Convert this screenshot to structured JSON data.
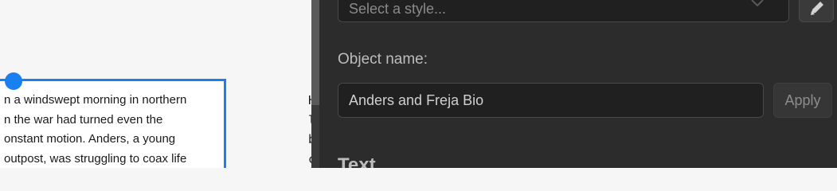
{
  "canvas": {
    "frame_lines": [
      "n a windswept morning in northern",
      "n the war had turned even the",
      "onstant motion. Anders, a young",
      "outpost, was struggling to coax life"
    ],
    "right_column_lines": [
      "H",
      "l",
      "b",
      "c"
    ]
  },
  "panel": {
    "style_select": {
      "placeholder": "Select a style..."
    },
    "object_name": {
      "label": "Object name:",
      "value": "Anders and Freja Bio"
    },
    "apply_label": "Apply",
    "section_heading": "Text"
  },
  "icons": {
    "select_chevron": "chevron-down-icon",
    "edit": "pencil-icon"
  },
  "colors": {
    "selection": "#1a80f0",
    "panel_bg": "#2c2c2c",
    "input_bg": "#202020"
  }
}
